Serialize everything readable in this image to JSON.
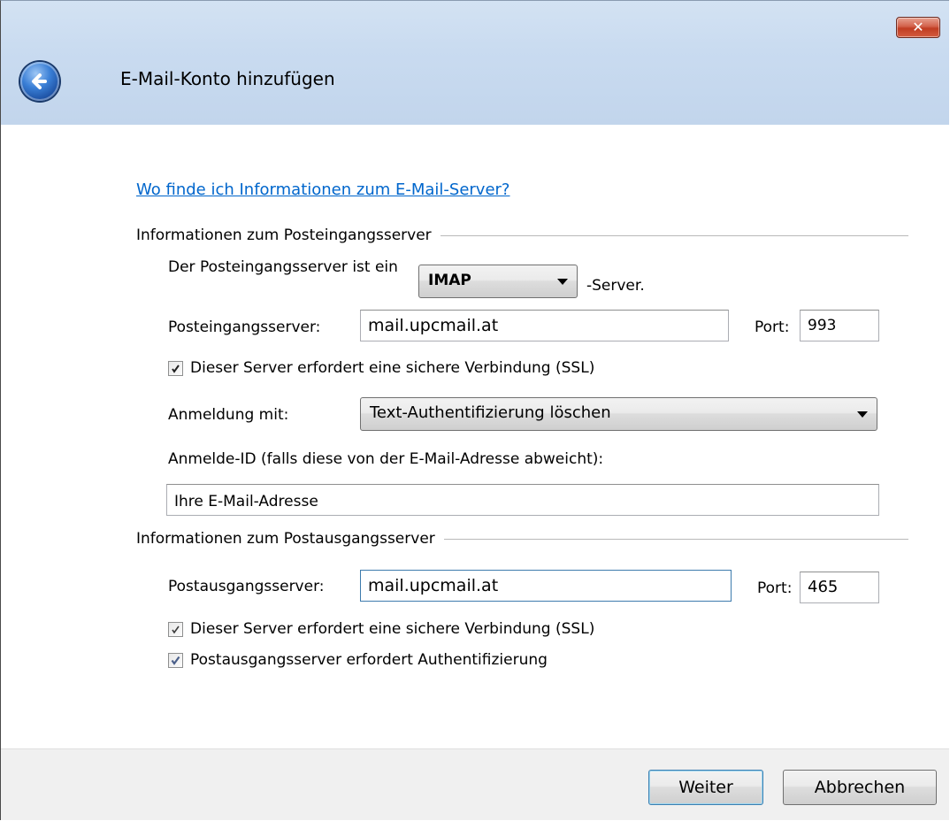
{
  "window": {
    "title": "E-Mail-Konto hinzufügen",
    "close_label": "✕"
  },
  "help_link": "Wo finde ich Informationen zum E-Mail-Server?",
  "incoming": {
    "group_title": "Informationen zum Posteingangsserver",
    "type_label": "Der Posteingangsserver ist ein",
    "type_value": "IMAP",
    "type_suffix": "-Server.",
    "server_label": "Posteingangsserver:",
    "server_value": "mail.upcmail.at",
    "port_label": "Port:",
    "port_value": "993",
    "ssl_label": "Dieser Server erfordert eine sichere Verbindung (SSL)",
    "ssl_checked": true,
    "auth_label": "Anmeldung mit:",
    "auth_value": "Text-Authentifizierung löschen",
    "login_id_label": "Anmelde-ID (falls diese von der E-Mail-Adresse abweicht):",
    "login_id_value": "Ihre E-Mail-Adresse"
  },
  "outgoing": {
    "group_title": "Informationen zum Postausgangsserver",
    "server_label": "Postausgangsserver:",
    "server_value": "mail.upcmail.at",
    "port_label": "Port:",
    "port_value": "465",
    "ssl_label": "Dieser Server erfordert eine sichere Verbindung (SSL)",
    "ssl_checked": true,
    "auth_required_label": "Postausgangsserver erfordert Authentifizierung",
    "auth_required_checked": true
  },
  "footer": {
    "next_label": "Weiter",
    "cancel_label": "Abbrechen"
  },
  "colors": {
    "link": "#0066cc",
    "title_bar": "#c9dbf0",
    "close_button": "#c94a31",
    "footer": "#f0f0f0"
  }
}
